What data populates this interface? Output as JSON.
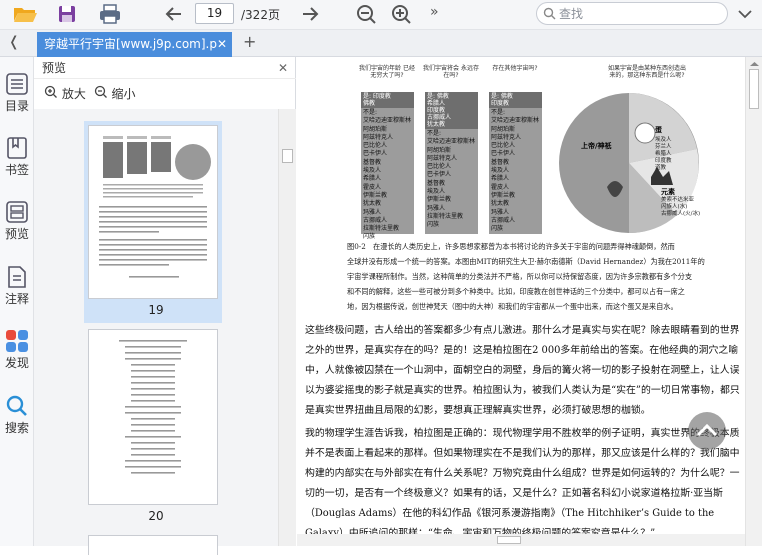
{
  "toolbar": {
    "page_current": "19",
    "page_total": "/322页",
    "search_placeholder": "查找",
    "more_symbol": "»"
  },
  "tab": {
    "title": "穿越平行宇宙[www.j9p.com].p",
    "close": "✕",
    "add": "+"
  },
  "sidebar": {
    "collapse": "❬",
    "items": [
      {
        "label": "目录",
        "icon": "toc-icon"
      },
      {
        "label": "书签",
        "icon": "bookmark-icon"
      },
      {
        "label": "预览",
        "icon": "preview-icon"
      },
      {
        "label": "注释",
        "icon": "annotation-icon"
      },
      {
        "label": "发现",
        "icon": "discover-icon"
      },
      {
        "label": "搜索",
        "icon": "search-icon"
      }
    ]
  },
  "panel": {
    "title": "预览",
    "close": "✕",
    "zoom_in": "放大",
    "zoom_out": "缩小",
    "thumbnails": [
      "19",
      "20"
    ]
  },
  "figure": {
    "columns": [
      {
        "head": "我们宇宙的年龄\n已经无穷大了吗?",
        "yes": "是: 印度教\n佛教",
        "no_label": "不是:",
        "items": [
          "艾哈迈迪亚穆斯林",
          "阿胡珀斯",
          "阿兹特克人",
          "巴比伦人",
          "巴卡伊人",
          "基督教",
          "埃及人",
          "希腊人",
          "霍皮人",
          "伊斯兰教",
          "犹太教",
          "玛雅人",
          "古挪威人",
          "拉斯特法里教",
          "闪族"
        ]
      },
      {
        "head": "我们宇宙将会\n永远存在吗?",
        "yes": "是: 佛教\n希腊人\n印度教\n古挪威人\n犹太教",
        "no_label": "不是:",
        "items": [
          "艾哈迈迪亚穆斯林",
          "阿胡珀斯",
          "阿兹特克人",
          "巴比伦人",
          "巴卡伊人",
          "基督教",
          "埃及人",
          "伊斯兰教",
          "玛雅人",
          "拉斯特法里教",
          "闪族"
        ]
      },
      {
        "head": "存在其他宇宙吗?",
        "yes": "是: 佛教\n印度教",
        "no_label": "不是:",
        "items": [
          "艾哈迈迪亚穆斯林",
          "阿胡珀斯",
          "阿兹特克人",
          "巴比伦人",
          "巴卡伊人",
          "基督教",
          "埃及人",
          "希腊人",
          "霍皮人",
          "伊斯兰教",
          "犹太教",
          "玛雅人",
          "古挪威人",
          "闪族"
        ]
      }
    ],
    "pie_head": "如果宇宙是由某种东西创造出\n来的，那这种东西是什么呢?",
    "pie_labels": [
      "上帝/神祇",
      "蛋",
      "元素"
    ],
    "pie_sub_egg": "埃及人\n芬兰人\n希腊人\n印度教\n道教",
    "pie_sub_elem": "美索不达米亚\n闪族人(水)\n古挪威人(火/冰)"
  },
  "caption": [
    "图0-2　在漫长的人类历史上，许多思想家都曾为本书将讨论的许多关于宇宙的问题弄得神魂颠倒，然而",
    "全球并没有形成一个统一的答案。本图由MIT的研究生大卫·赫尔南德斯（David Hernandez）为我在2011年的",
    "宇宙学课程所制作。当然，这种简单的分类法并不严格，所以你可以持保留态度，因为许多宗教都有多个分支",
    "和不同的解释，这些一些可被分到多个种类中。比如，印度教在创世神话的三个分类中，都可以占有一席之",
    "地，因为根据传说，创世神梵天（图中的大神）和我们的宇宙都从一个蛋中出来，而这个蛋又是来自水。"
  ],
  "paragraphs": [
    "这些终极问题，古人给出的答案都多少有点儿激进。那什么才是真实与实在呢？除去眼睛看到的世界之外的世界，是真实存在的吗？是的！这是柏拉图在2 000多年前给出的答案。在他经典的洞穴之喻中，人就像被囚禁在一个山洞中，面朝空白的洞壁，身后的篝火将一切的影子投射在洞壁上，让人误以为婆娑摇曳的影子就是真实的世界。柏拉图认为，被我们人类认为是“实在”的一切日常事物，都只是真实世界扭曲且局限的幻影，要想真正理解真实世界，必须打破思想的枷锁。",
    "我的物理学生涯告诉我，柏拉图是正确的：现代物理学用不胜枚举的例子证明，真实世界的终极本质并不是表面上看起来的那样。但如果物理实在不是我们认为的那样，那又应该是什么样的？我们脑中构建的内部实在与外部实在有什么关系呢？万物究竟由什么组成？世界是如何运转的？为什么呢？一切的一切，是否有一个终极意义？如果有的话，又是什么？正如著名科幻小说家道格拉斯·亚当斯（Douglas Adams）在他的科幻作品《银河系漫游指南》（The Hitchhiker’s Guide to the Galaxy）中所追问的那样：“生命、宇宙和万物的终极问题的答案究竟是什么？”"
  ],
  "colors": {
    "accent": "#4a8ddc",
    "selection": "#cfe2f8",
    "discover_1": "#e94b3c",
    "discover_2": "#f5a623",
    "discover_3": "#4a90e2"
  }
}
